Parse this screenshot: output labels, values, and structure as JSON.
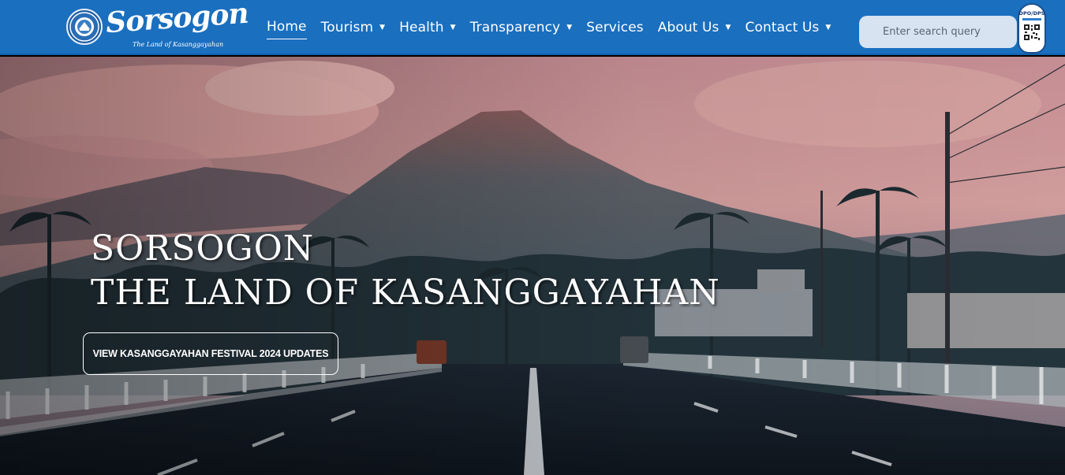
{
  "brand": {
    "name": "Sorsogon",
    "tagline": "The Land of Kasanggayahan",
    "seal_icon": "provincial-seal-icon"
  },
  "nav": {
    "items": [
      {
        "label": "Home",
        "active": true,
        "dropdown": false
      },
      {
        "label": "Tourism",
        "active": false,
        "dropdown": true
      },
      {
        "label": "Health",
        "active": false,
        "dropdown": true
      },
      {
        "label": "Transparency",
        "active": false,
        "dropdown": true
      },
      {
        "label": "Services",
        "active": false,
        "dropdown": false
      },
      {
        "label": "About Us",
        "active": false,
        "dropdown": true
      },
      {
        "label": "Contact Us",
        "active": false,
        "dropdown": true
      }
    ],
    "caret": "▼"
  },
  "search": {
    "placeholder": "Enter search query",
    "value": ""
  },
  "badge": {
    "label": "DPO/DPS",
    "icon": "privacy-seal-qr-icon"
  },
  "hero": {
    "title_line1": "SORSOGON",
    "title_line2": "THE LAND OF KASANGGAYAHAN",
    "cta_label": "VIEW KASANGGAYAHAN FESTIVAL 2024 UPDATES"
  },
  "colors": {
    "navbar": "#1a6fbf",
    "search_bg": "#d7e3f0",
    "sky_top": "#c98f95",
    "mountain": "#4e6570"
  }
}
